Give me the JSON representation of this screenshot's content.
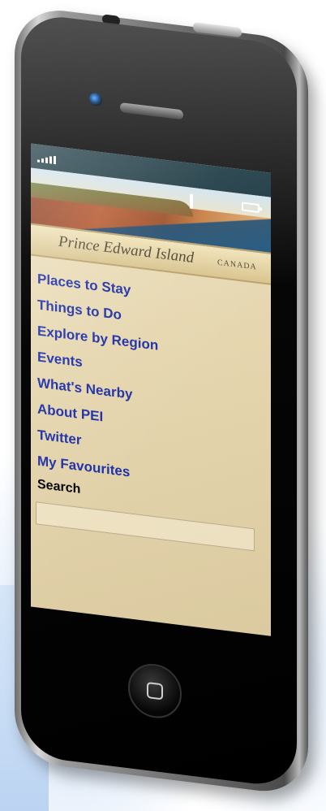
{
  "header": {
    "title": "Prince Edward Island",
    "country": "CANADA"
  },
  "status_bar": {
    "signal_icon": "signal-bars-icon",
    "battery_icon": "battery-icon"
  },
  "menu": {
    "items": [
      {
        "label": "Places to Stay"
      },
      {
        "label": "Things to Do"
      },
      {
        "label": "Explore by Region"
      },
      {
        "label": "Events"
      },
      {
        "label": "What's Nearby"
      },
      {
        "label": "About PEI"
      },
      {
        "label": "Twitter"
      },
      {
        "label": "My Favourites"
      }
    ]
  },
  "search": {
    "label": "Search",
    "value": "",
    "placeholder": ""
  },
  "colors": {
    "link": "#1d2fa6",
    "parchment": "#e6d7b0",
    "status_bar": "#12303a"
  }
}
